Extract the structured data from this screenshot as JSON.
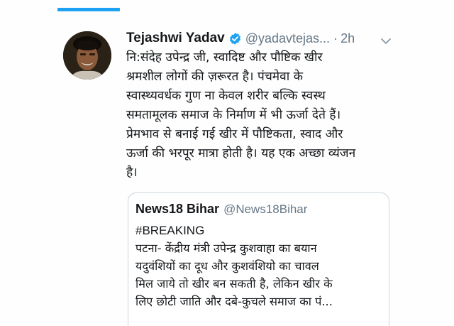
{
  "accent_color": "#1da1f2",
  "tweet": {
    "author": {
      "display_name": "Tejashwi Yadav",
      "handle": "@yadavtejas...",
      "verified_icon": "verified-badge-icon",
      "avatar_icon": "user-avatar"
    },
    "separator": "·",
    "time": "2h",
    "menu_icon": "chevron-down-icon",
    "text_lines": [
      "नि:संदेह उपेन्द्र जी, स्वादिष्ट और पौष्टिक खीर",
      "श्रमशील लोगों की ज़रूरत है। पंचमेवा के",
      "स्वास्थ्यवर्धक गुण ना केवल शरीर बल्कि स्वस्थ",
      "समतामूलक समाज के निर्माण में भी ऊर्जा देते हैं।",
      "प्रेमभाव से बनाई गई खीर में पौष्टिकता, स्वाद और",
      "ऊर्जा की भरपूर मात्रा होती है। यह एक अच्छा व्यंजन",
      "है।"
    ]
  },
  "quoted_tweet": {
    "display_name": "News18 Bihar",
    "handle": "@News18Bihar",
    "text_lines": [
      "#BREAKING",
      "पटना- केंद्रीय मंत्री उपेन्द्र कुशवाहा का बयान",
      "यदुवंशियों का दूध और कुशवंशियो का चावल",
      "मिल जाये तो खीर बन सकती है, लेकिन खीर के",
      "लिए छोटी जाति और दबे-कुचले समाज का पं..."
    ]
  }
}
